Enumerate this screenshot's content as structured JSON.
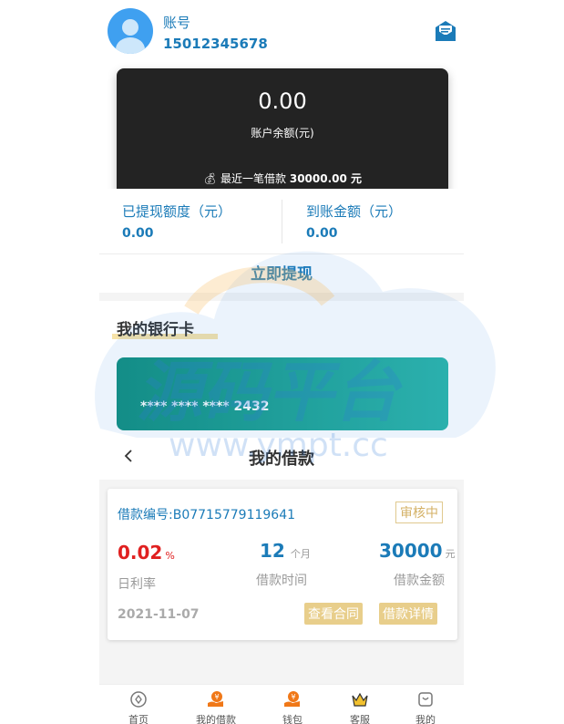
{
  "account": {
    "label": "账号",
    "phone": "15012345678"
  },
  "balance": {
    "amount": "0.00",
    "label": "账户余额(元)",
    "recent_prefix": "最近一笔借款",
    "recent_value": "30000.00 元"
  },
  "stats": {
    "withdrawn_label": "已提现额度（元）",
    "withdrawn_value": "0.00",
    "arrived_label": "到账金额（元）",
    "arrived_value": "0.00"
  },
  "withdraw_button": "立即提现",
  "bank": {
    "title": "我的银行卡",
    "card_number": "**** **** **** 2432"
  },
  "loans": {
    "title": "我的借款",
    "item": {
      "number": "借款编号:B07715779119641",
      "status": "审核中",
      "rate_value": "0.02",
      "rate_unit": "%",
      "rate_label": "日利率",
      "term_value": "12",
      "term_unit": "个月",
      "term_label": "借款时间",
      "amount_value": "30000",
      "amount_unit": "元",
      "amount_label": "借款金额",
      "date": "2021-11-07",
      "contract_button": "查看合同",
      "detail_button": "借款详情"
    }
  },
  "tabbar": [
    {
      "label": "首页",
      "icon": "home-icon"
    },
    {
      "label": "我的借款",
      "icon": "loan-icon"
    },
    {
      "label": "钱包",
      "icon": "wallet-icon"
    },
    {
      "label": "客服",
      "icon": "crown-icon"
    },
    {
      "label": "我的",
      "icon": "profile-icon"
    }
  ],
  "watermark": {
    "text": "源码平台",
    "url": "www.ympt.cc"
  },
  "colors": {
    "brand_blue": "#1b7bb8",
    "gold": "#e8ce8b",
    "red": "#e02020",
    "dark_card": "#232323",
    "teal_card": "#1aa294"
  }
}
